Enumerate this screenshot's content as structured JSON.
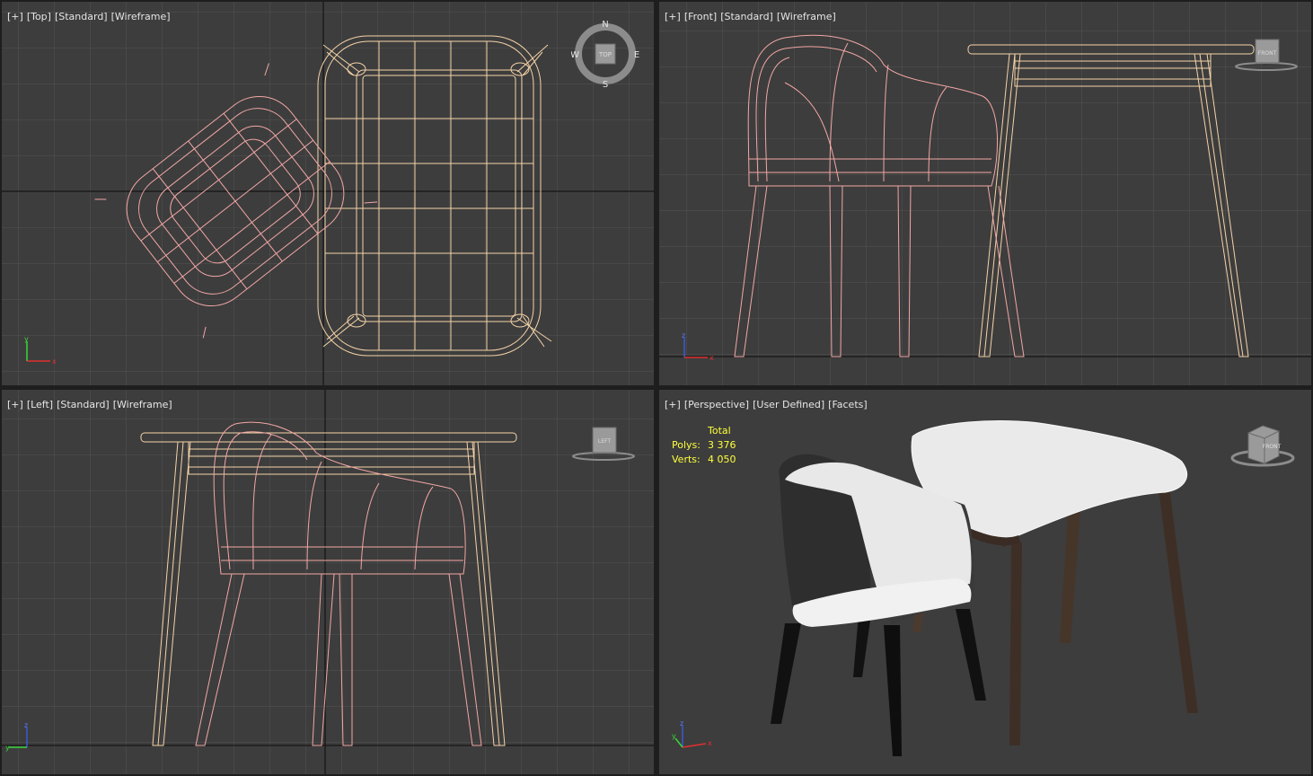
{
  "viewports": {
    "top": {
      "plus": "[+]",
      "view": "[Top]",
      "shading": "[Standard]",
      "mode": "[Wireframe]",
      "compass": {
        "n": "N",
        "s": "S",
        "e": "E",
        "w": "W",
        "cube": "TOP"
      }
    },
    "front": {
      "plus": "[+]",
      "view": "[Front]",
      "shading": "[Standard]",
      "mode": "[Wireframe]",
      "cube": "FRONT"
    },
    "left": {
      "plus": "[+]",
      "view": "[Left]",
      "shading": "[Standard]",
      "mode": "[Wireframe]",
      "cube": "LEFT"
    },
    "perspective": {
      "plus": "[+]",
      "view": "[Perspective]",
      "shading": "[User Defined]",
      "mode": "[Facets]",
      "cube": "FRONT",
      "stats": {
        "header": "Total",
        "polys_label": "Polys:",
        "polys": "3 376",
        "verts_label": "Verts:",
        "verts": "4 050"
      }
    }
  },
  "axis": {
    "x": "x",
    "y": "y",
    "z": "z"
  },
  "colors": {
    "viewport_bg": "#3d3d3d",
    "grid": "#555555",
    "axis_line": "#111111",
    "chair_wire": "#f2a7a5",
    "table_wire": "#f5d3a8",
    "active_border": "#b5a44b",
    "stats_text": "#ffff3c"
  }
}
